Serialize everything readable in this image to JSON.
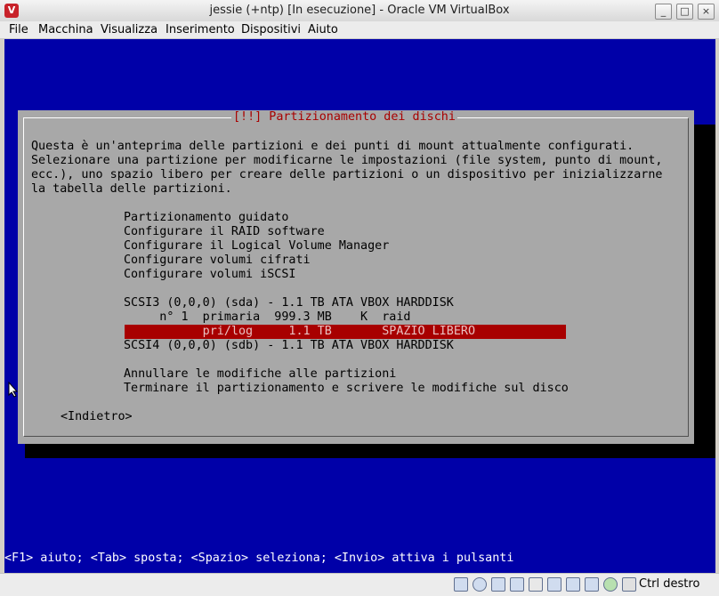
{
  "window": {
    "title": "jessie (+ntp) [In esecuzione] - Oracle VM VirtualBox",
    "app_icon": "virtualbox-icon",
    "controls": [
      "minimize-icon",
      "maximize-icon",
      "close-icon"
    ]
  },
  "menubar": {
    "items": [
      "File",
      "Macchina",
      "Visualizza",
      "Inserimento",
      "Dispositivi",
      "Aiuto"
    ]
  },
  "installer": {
    "dialog_title": "[!!] Partizionamento dei dischi",
    "description": [
      "Questa è un'anteprima delle partizioni e dei punti di mount attualmente configurati.",
      "Selezionare una partizione per modificarne le impostazioni (file system, punto di mount,",
      "ecc.), uno spazio libero per creare delle partizioni o un dispositivo per inizializzarne",
      "la tabella delle partizioni."
    ],
    "actions": [
      "Partizionamento guidato",
      "Configurare il RAID software",
      "Configurare il Logical Volume Manager",
      "Configurare volumi cifrati",
      "Configurare volumi iSCSI"
    ],
    "disks": {
      "disk1": "SCSI3 (0,0,0) (sda) - 1.1 TB ATA VBOX HARDDISK",
      "partition1": "     n° 1  primaria  999.3 MB    K  raid",
      "free_space_selected": "           pri/log     1.1 TB       SPAZIO LIBERO",
      "disk2": "SCSI4 (0,0,0) (sdb) - 1.1 TB ATA VBOX HARDDISK"
    },
    "final_actions": [
      "Annullare le modifiche alle partizioni",
      "Terminare il partizionamento e scrivere le modifiche sul disco"
    ],
    "back_button": "<Indietro>"
  },
  "help_line": "<F1> aiuto; <Tab> sposta; <Spazio> seleziona; <Invio> attiva i pulsanti",
  "statusbar": {
    "icons": [
      "harddisk-icon",
      "optical-drive-icon",
      "usb-icon",
      "shared-folders-icon",
      "display-icon",
      "network-icon",
      "video-capture-icon",
      "mouse-integration-icon",
      "cpu-icon",
      "host-key-icon"
    ],
    "host_key": "Ctrl destro"
  },
  "colors": {
    "screen_bg": "#0000a8",
    "dialog_bg": "#a8a8a8",
    "selection": "#a80000",
    "title_text": "#a80000"
  }
}
